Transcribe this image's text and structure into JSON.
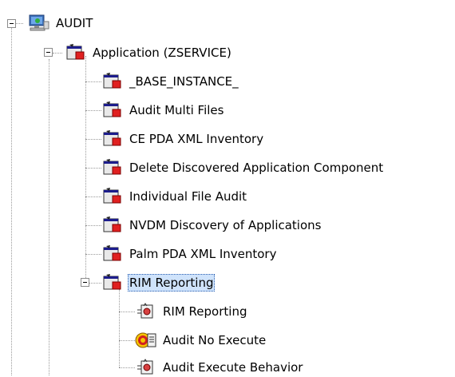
{
  "tree": {
    "root": {
      "label": "AUDIT",
      "icon": "audit-computer-icon",
      "expanded": true
    },
    "application": {
      "label": "Application (ZSERVICE)",
      "icon": "application-class-icon",
      "expanded": true
    },
    "instances": [
      {
        "label": "_BASE_INSTANCE_",
        "icon": "application-instance-icon"
      },
      {
        "label": "Audit Multi Files",
        "icon": "application-instance-icon"
      },
      {
        "label": "CE PDA XML Inventory",
        "icon": "application-instance-icon"
      },
      {
        "label": "Delete Discovered Application Component",
        "icon": "application-instance-icon"
      },
      {
        "label": "Individual File Audit",
        "icon": "application-instance-icon"
      },
      {
        "label": "NVDM Discovery of Applications",
        "icon": "application-instance-icon"
      },
      {
        "label": "Palm PDA XML Inventory",
        "icon": "application-instance-icon"
      },
      {
        "label": "RIM Reporting",
        "icon": "application-instance-icon",
        "expanded": true,
        "selected": true
      }
    ],
    "rim_children": [
      {
        "label": "RIM Reporting",
        "icon": "behavior-icon"
      },
      {
        "label": "Audit No Execute",
        "icon": "no-execute-icon"
      },
      {
        "label": "Audit Execute Behavior",
        "icon": "behavior-icon"
      }
    ]
  },
  "colors": {
    "selection_bg": "#cfe3fb",
    "selection_border": "#2a5fb0",
    "connector": "#9a9a9a"
  }
}
